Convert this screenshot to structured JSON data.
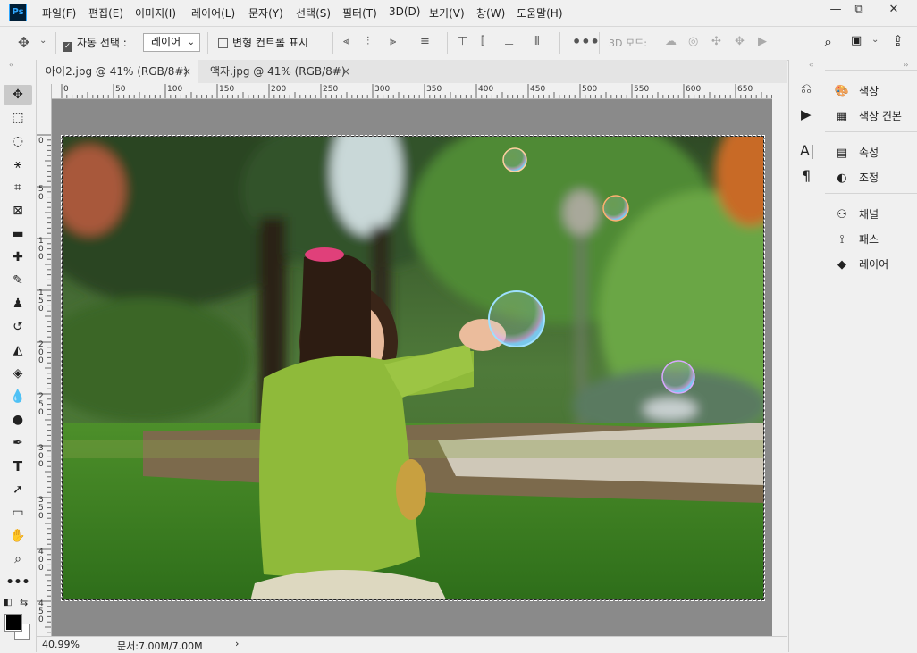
{
  "app": {
    "logo_text": "Ps"
  },
  "menu": [
    "파일(F)",
    "편집(E)",
    "이미지(I)",
    "레이어(L)",
    "문자(Y)",
    "선택(S)",
    "필터(T)",
    "3D(D)",
    "보기(V)",
    "창(W)",
    "도움말(H)"
  ],
  "window_buttons": {
    "minimize": "—",
    "restore": "⧉",
    "close": "✕"
  },
  "options": {
    "auto_select_label": "자동 선택 :",
    "auto_select_checked": true,
    "layer_select_value": "레이어",
    "transform_controls_label": "변형 컨트롤 표시",
    "mode_3d_label": "3D 모드:"
  },
  "tabs": [
    {
      "label": "아이2.jpg @ 41% (RGB/8#)",
      "close": "×",
      "active": true
    },
    {
      "label": "액자.jpg @ 41% (RGB/8#)",
      "close": "×",
      "active": false
    }
  ],
  "ruler": {
    "h_labels": [
      "0",
      "50",
      "100",
      "150",
      "200",
      "250",
      "300",
      "350",
      "400",
      "450",
      "500",
      "550",
      "600",
      "650"
    ],
    "v_labels": [
      "0",
      "50",
      "100",
      "150",
      "200",
      "250",
      "300",
      "350",
      "400",
      "450"
    ]
  },
  "status": {
    "zoom": "40.99%",
    "doc_info": "문서:7.00M/7.00M",
    "arrow": "›"
  },
  "panels": {
    "group1": [
      {
        "icon": "palette-icon",
        "label": "색상"
      },
      {
        "icon": "swatches-icon",
        "label": "색상 견본"
      }
    ],
    "group2": [
      {
        "icon": "properties-icon",
        "label": "속성"
      },
      {
        "icon": "adjustments-icon",
        "label": "조정"
      }
    ],
    "group3": [
      {
        "icon": "channels-icon",
        "label": "채널"
      },
      {
        "icon": "paths-icon",
        "label": "패스"
      },
      {
        "icon": "layers-icon",
        "label": "레이어"
      }
    ]
  },
  "colors": {
    "foreground": "#000000",
    "background": "#ffffff",
    "canvas_bg": "#8a8a8a"
  }
}
